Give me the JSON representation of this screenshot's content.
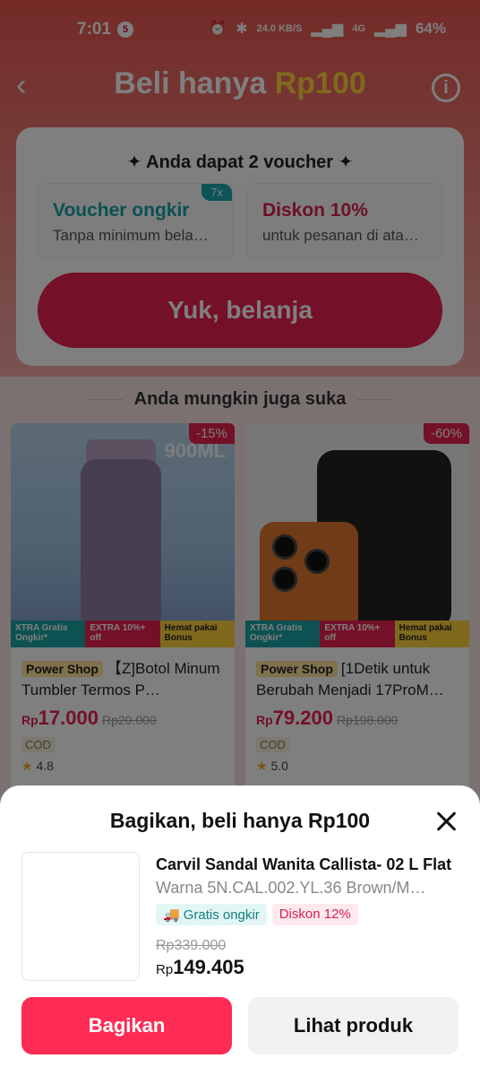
{
  "status_bar": {
    "time": "7:01",
    "notification_count": "5",
    "net_speed": "24.0 KB/S",
    "network": "4G",
    "battery": "64%"
  },
  "header": {
    "title": "Beli hanya ",
    "title_accent": "Rp100"
  },
  "voucher_card": {
    "heading": "✦ Anda dapat 2 voucher ✦",
    "vouchers": [
      {
        "title": "Voucher ongkir",
        "subtitle": "Tanpa minimum bela…",
        "badge": "7x"
      },
      {
        "title": "Diskon 10%",
        "subtitle": "untuk pesanan di ata…"
      }
    ],
    "shop_button": "Yuk, belanja"
  },
  "recommend": {
    "title": "Anda mungkin juga suka",
    "products": [
      {
        "discount": "-15%",
        "capacity": "900ML",
        "shop_badge": "Power Shop",
        "name": "【Z]Botol Minum Tumbler Termos P…",
        "currency": "Rp",
        "price": "17.000",
        "old_price": "Rp20.000",
        "cod": "COD",
        "rating": "4.8",
        "promo": [
          "XTRA Gratis Ongkir*",
          "EXTRA 10%+ off",
          "Hemat pakai Bonus"
        ]
      },
      {
        "discount": "-60%",
        "shop_badge": "Power Shop",
        "name": "[1Detik untuk Berubah Menjadi 17ProM…",
        "currency": "Rp",
        "price": "79.200",
        "old_price": "Rp198.000",
        "cod": "COD",
        "rating": "5.0",
        "promo": [
          "XTRA Gratis Ongkir*",
          "EXTRA 10%+ off",
          "Hemat pakai Bonus"
        ]
      }
    ]
  },
  "sheet": {
    "title": "Bagikan, beli hanya Rp100",
    "product_name": "Carvil Sandal Wanita Callista- 02 L Flat",
    "variant": "Warna 5N.CAL.002.YL.36 Brown/M…",
    "tag_shipping": "Gratis ongkir",
    "tag_discount": "Diskon 12%",
    "old_price": "Rp339.000",
    "currency": "Rp",
    "price": "149.405",
    "share_button": "Bagikan",
    "view_button": "Lihat produk"
  },
  "colors": {
    "accent": "#fe2c55",
    "teal": "#18a9ad",
    "gold": "#ffd43a"
  }
}
